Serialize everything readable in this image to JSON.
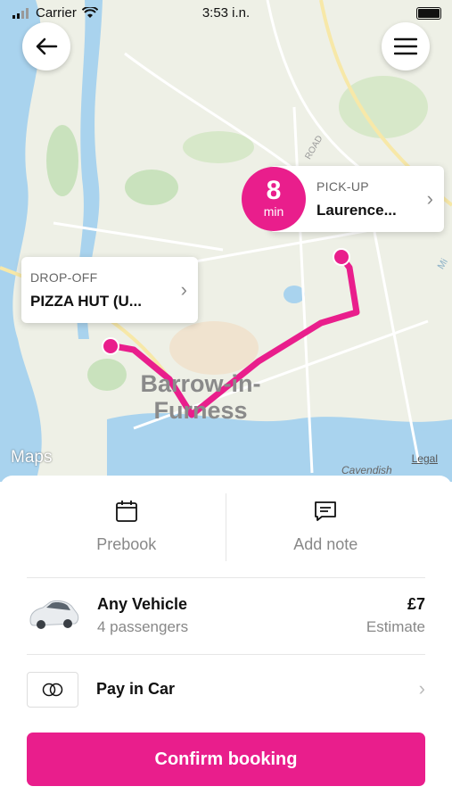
{
  "status_bar": {
    "carrier": "Carrier",
    "time": "3:53 i.n."
  },
  "map": {
    "pickup": {
      "label": "PICK-UP",
      "value": "Laurence..."
    },
    "dropoff": {
      "label": "DROP-OFF",
      "value": "PIZZA HUT (U..."
    },
    "eta": {
      "value": "8",
      "unit": "min"
    },
    "town_line1": "Barrow-in-",
    "town_line2": "Furness",
    "road_label": "ROAD",
    "street_label": "Cavendish",
    "corner_label": "Mi",
    "attribution": "Maps",
    "legal": "Legal",
    "route_color": "#e91e8c"
  },
  "actions": {
    "prebook": "Prebook",
    "add_note": "Add note"
  },
  "vehicle": {
    "name": "Any Vehicle",
    "passengers": "4 passengers",
    "price": "£7",
    "estimate": "Estimate"
  },
  "payment": {
    "method": "Pay in Car"
  },
  "confirm": "Confirm booking"
}
